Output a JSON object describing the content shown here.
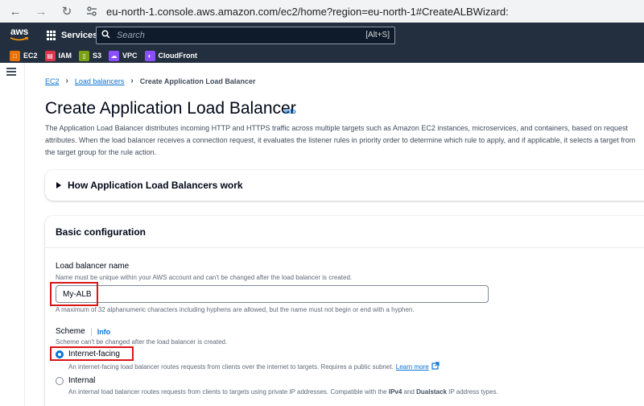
{
  "browser": {
    "url": "eu-north-1.console.aws.amazon.com/ec2/home?region=eu-north-1#CreateALBWizard:"
  },
  "aws_nav": {
    "logo": "aws",
    "services_label": "Services",
    "search_placeholder": "Search",
    "search_shortcut": "[Alt+S]"
  },
  "favorites": [
    {
      "label": "EC2",
      "icon": "ec2-icon",
      "color": "#ed7100"
    },
    {
      "label": "IAM",
      "icon": "iam-icon",
      "color": "#dd344c"
    },
    {
      "label": "S3",
      "icon": "s3-icon",
      "color": "#7aa116"
    },
    {
      "label": "VPC",
      "icon": "vpc-icon",
      "color": "#8c4fff"
    },
    {
      "label": "CloudFront",
      "icon": "cloudfront-icon",
      "color": "#8c4fff"
    }
  ],
  "breadcrumb": {
    "items": [
      "EC2",
      "Load balancers"
    ],
    "current": "Create Application Load Balancer"
  },
  "page": {
    "title": "Create Application Load Balancer",
    "info": "Info",
    "description": "The Application Load Balancer distributes incoming HTTP and HTTPS traffic across multiple targets such as Amazon EC2 instances, microservices, and containers, based on request attributes. When the load balancer receives a connection request, it evaluates the listener rules in priority order to determine which rule to apply, and if applicable, it selects a target from the target group for the rule action."
  },
  "how_panel": {
    "title": "How Application Load Balancers work"
  },
  "basic_config": {
    "title": "Basic configuration",
    "name_label": "Load balancer name",
    "name_desc": "Name must be unique within your AWS account and can't be changed after the load balancer is created.",
    "name_value": "My-ALB",
    "name_constraint": "A maximum of 32 alphanumeric characters including hyphens are allowed, but the name must not begin or end with a hyphen.",
    "scheme_label": "Scheme",
    "scheme_info": "Info",
    "scheme_desc": "Scheme can't be changed after the load balancer is created.",
    "internet_facing_label": "Internet-facing",
    "internet_facing_desc": "An internet-facing load balancer routes requests from clients over the internet to targets. Requires a public subnet.",
    "learn_more": "Learn more",
    "internal_label": "Internal",
    "internal_desc_1": "An internal load balancer routes requests from clients to targets using private IP addresses. Compatible with the ",
    "internal_ipv4": "IPv4",
    "internal_desc_2": " and ",
    "internal_dualstack": "Dualstack",
    "internal_desc_3": " IP address types.",
    "selected_scheme": "Internet-facing"
  },
  "colors": {
    "nav_bg": "#232f3e",
    "link": "#0972d3",
    "highlight": "#d91515"
  }
}
